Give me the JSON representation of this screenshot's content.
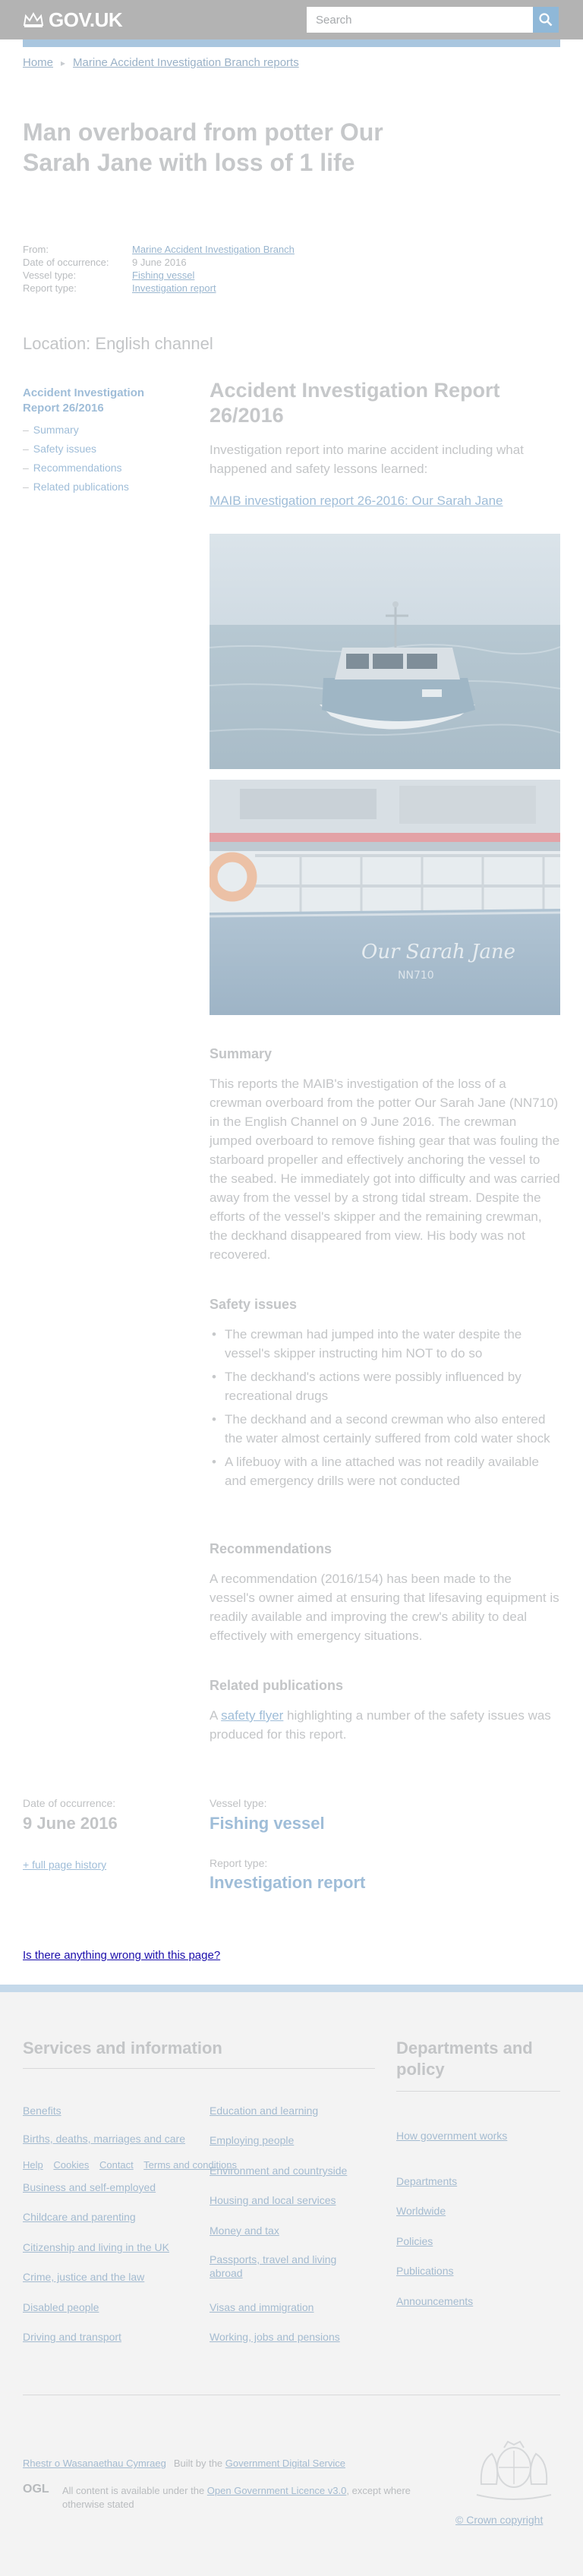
{
  "header": {
    "logo_text": "GOV.UK",
    "search_placeholder": "Search"
  },
  "breadcrumb": [
    "Home",
    "Marine Accident Investigation Branch reports"
  ],
  "title": "Man overboard from potter Our Sarah Jane with loss of 1 life",
  "meta": [
    {
      "key": "From:",
      "value": "Marine Accident Investigation Branch",
      "link": true
    },
    {
      "key": "Date of occurrence:",
      "value": "9 June 2016",
      "link": false
    },
    {
      "key": "Vessel type:",
      "value": "Fishing vessel",
      "link": true
    },
    {
      "key": "Report type:",
      "value": "Investigation report",
      "link": true
    }
  ],
  "location": "Location: English channel",
  "contents": {
    "title": "Accident Investigation Report 26/2016",
    "items": [
      "Summary",
      "Safety issues",
      "Recommendations",
      "Related publications"
    ]
  },
  "main": {
    "heading": "Accident Investigation Report 26/2016",
    "intro": "Investigation report into marine accident including what happened and safety lessons learned:",
    "report_link": "MAIB investigation report 26-2016: Our Sarah Jane",
    "photo2_boat_name": "Our Sarah Jane",
    "photo2_reg": "NN710"
  },
  "summary": {
    "heading": "Summary",
    "text": "This reports the MAIB's investigation of the loss of a crewman overboard from the potter Our Sarah Jane (NN710) in the English Channel on 9 June 2016. The crewman jumped overboard to remove fishing gear that was fouling the starboard propeller and effectively anchoring the vessel to the seabed. He immediately got into difficulty and was carried away from the vessel by a strong tidal stream. Despite the efforts of the vessel's skipper and the remaining crewman, the deckhand disappeared from view. His body was not recovered."
  },
  "safety": {
    "heading": "Safety issues",
    "items": [
      "The crewman had jumped into the water despite the vessel's skipper instructing him NOT to do so",
      "The deckhand's actions were possibly influenced by recreational drugs",
      "The deckhand and a second crewman who also entered the water almost certainly suffered from cold water shock",
      "A lifebuoy with a line attached was not readily available and emergency drills were not conducted"
    ]
  },
  "recommendations": {
    "heading": "Recommendations",
    "text": "A recommendation (2016/154) has been made to the vessel's owner aimed at ensuring that lifesaving equipment is readily available and improving the crew's ability to deal effectively with emergency situations."
  },
  "related": {
    "heading": "Related publications",
    "prefix": "A ",
    "link": "safety flyer",
    "suffix": " highlighting a number of the safety issues was produced for this report."
  },
  "bottom_meta": {
    "date_label": "Date of occurrence:",
    "date_value": "9 June 2016",
    "history_link": "+ full page history",
    "vessel_label": "Vessel type:",
    "vessel_value": "Fishing vessel",
    "report_label": "Report type:",
    "report_value": "Investigation report"
  },
  "useful": "Is there anything wrong with this page?",
  "footer": {
    "services_heading": "Services and information",
    "services_col1": [
      "Benefits",
      "Births, deaths, marriages and care",
      "Business and self-employed",
      "Childcare and parenting",
      "Citizenship and living in the UK",
      "Crime, justice and the law",
      "Disabled people",
      "Driving and transport"
    ],
    "services_col2": [
      "Education and learning",
      "Employing people",
      "Environment and countryside",
      "Housing and local services",
      "Money and tax",
      "Passports, travel and living abroad",
      "Visas and immigration",
      "Working, jobs and pensions"
    ],
    "departments_heading": "Departments and policy",
    "departments": [
      "How government works",
      "Departments",
      "Worldwide",
      "Policies",
      "Publications",
      "Announcements"
    ],
    "help_links": [
      "Help",
      "Cookies",
      "Contact",
      "Terms and conditions"
    ],
    "welsh": "Rhestr o Wasanaethau Cymraeg",
    "built_by_prefix": "Built by the ",
    "built_by_link": "Government Digital Service",
    "ogl": "OGL",
    "licence_prefix": "All content is available under the ",
    "licence_link": "Open Government Licence v3.0",
    "licence_suffix": ", except where otherwise stated",
    "copyright": "© Crown copyright"
  }
}
